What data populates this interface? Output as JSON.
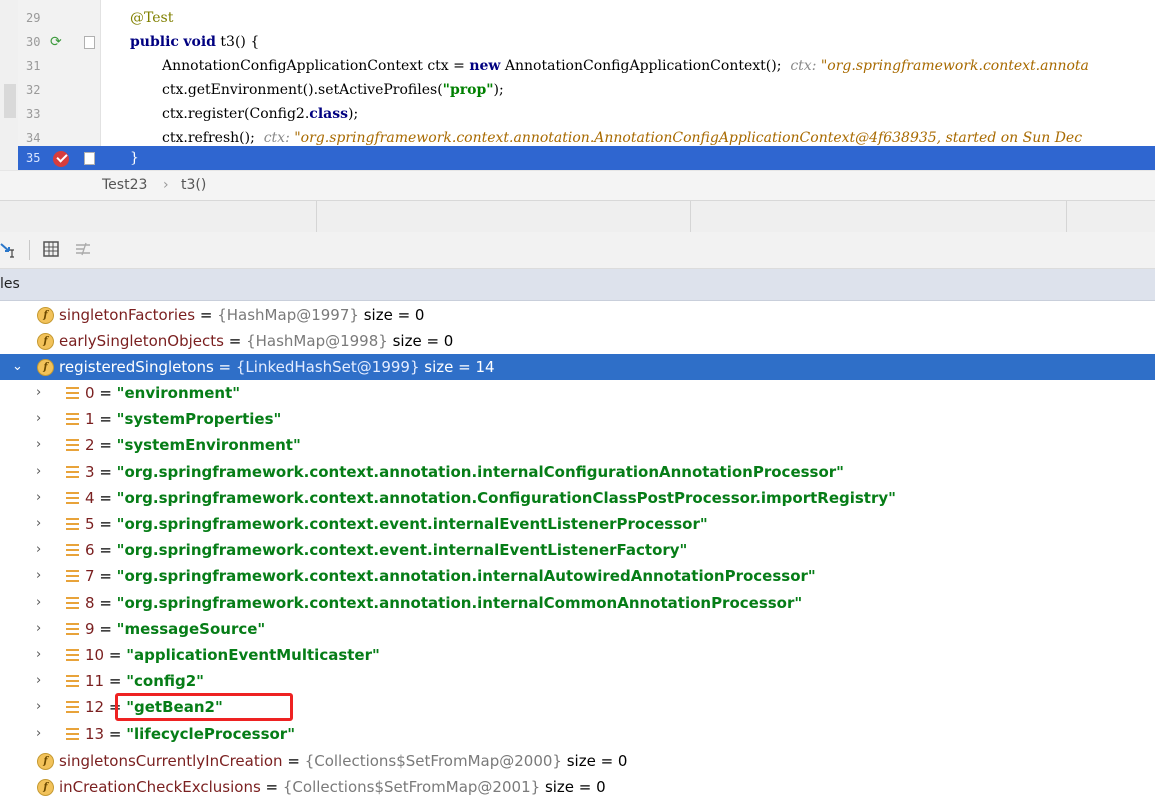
{
  "editor": {
    "lines": [
      {
        "num": "29",
        "annotation": "@Test"
      },
      {
        "num": "30",
        "kw1": "public",
        "kw2": "void",
        "rest": " t3() {"
      },
      {
        "num": "31",
        "code_a": "AnnotationConfigApplicationContext ctx = ",
        "kw": "new",
        "code_b": " AnnotationConfigApplicationContext();",
        "hint_label": "ctx: ",
        "hint_str": "\"org.springframework.context.annota"
      },
      {
        "num": "32",
        "code_a": "ctx.getEnvironment().setActiveProfiles(",
        "str": "\"prop\"",
        "code_b": ");"
      },
      {
        "num": "33",
        "code_a": "ctx.register(Config2.",
        "kw": "class",
        "code_b": ");"
      },
      {
        "num": "34",
        "code_a": "ctx.refresh();",
        "hint_label": "ctx: ",
        "hint_str": "\"org.springframework.context.annotation.AnnotationConfigApplicationContext@4f638935, started on Sun Dec"
      },
      {
        "num": "35",
        "code_a": "}"
      }
    ]
  },
  "breadcrumb": {
    "class_name": "Test23",
    "separator": "›",
    "method": "t3()"
  },
  "variables_panel": {
    "title": "les"
  },
  "tree": {
    "fields": [
      {
        "name": "singletonFactories",
        "ref": "{HashMap@1997}",
        "size": "size = 0"
      },
      {
        "name": "earlySingletonObjects",
        "ref": "{HashMap@1998}",
        "size": "size = 0"
      },
      {
        "name": "registeredSingletons",
        "ref": "{LinkedHashSet@1999}",
        "size": "size = 14"
      }
    ],
    "items": [
      {
        "index": "0",
        "value": "\"environment\""
      },
      {
        "index": "1",
        "value": "\"systemProperties\""
      },
      {
        "index": "2",
        "value": "\"systemEnvironment\""
      },
      {
        "index": "3",
        "value": "\"org.springframework.context.annotation.internalConfigurationAnnotationProcessor\""
      },
      {
        "index": "4",
        "value": "\"org.springframework.context.annotation.ConfigurationClassPostProcessor.importRegistry\""
      },
      {
        "index": "5",
        "value": "\"org.springframework.context.event.internalEventListenerProcessor\""
      },
      {
        "index": "6",
        "value": "\"org.springframework.context.event.internalEventListenerFactory\""
      },
      {
        "index": "7",
        "value": "\"org.springframework.context.annotation.internalAutowiredAnnotationProcessor\""
      },
      {
        "index": "8",
        "value": "\"org.springframework.context.annotation.internalCommonAnnotationProcessor\""
      },
      {
        "index": "9",
        "value": "\"messageSource\""
      },
      {
        "index": "10",
        "value": "\"applicationEventMulticaster\""
      },
      {
        "index": "11",
        "value": "\"config2\""
      },
      {
        "index": "12",
        "value": "\"getBean2\""
      },
      {
        "index": "13",
        "value": "\"lifecycleProcessor\""
      }
    ],
    "after_fields": [
      {
        "name": "singletonsCurrentlyInCreation",
        "ref": "{Collections$SetFromMap@2000}",
        "size": "size = 0"
      },
      {
        "name": "inCreationCheckExclusions",
        "ref": "{Collections$SetFromMap@2001}",
        "size": "size = 0"
      }
    ],
    "equals": " = "
  },
  "colors": {
    "selection": "#2f6fc8",
    "current_line": "#2f66d0",
    "string_value": "#067d17",
    "highlight_box": "#ee2222"
  }
}
